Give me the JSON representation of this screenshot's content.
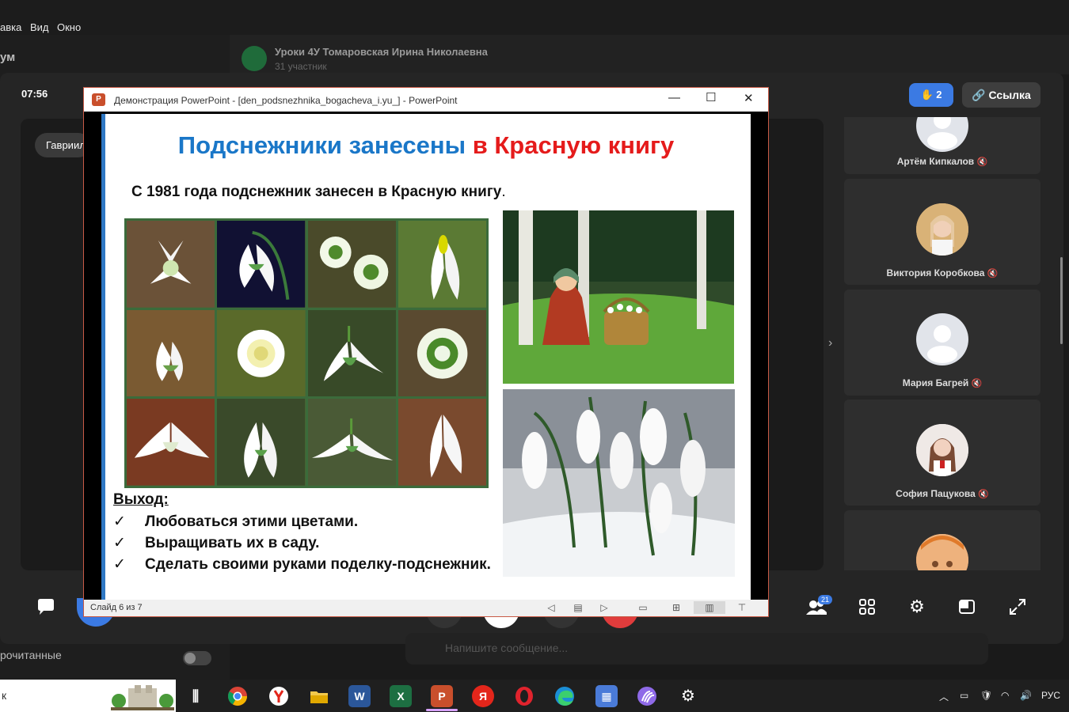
{
  "menubar": {
    "items": [
      "авка",
      "Вид",
      "Окно"
    ]
  },
  "messenger": {
    "app_name": "ум",
    "chat_title": "Уроки 4У Томаровская Ирина Николаевна",
    "chat_subtitle": "31 участник",
    "unread_label": "рочитанные",
    "message_placeholder": "Напишите сообщение..."
  },
  "call": {
    "timer": "07:56",
    "speaker_name": "Гавриил",
    "raised_hands": "2",
    "link_button": "Ссылка",
    "participants_count": "21",
    "participants": [
      {
        "name": "Артём Кипкалов",
        "avatar": "default-avatar-icon"
      },
      {
        "name": "Виктория Коробкова",
        "avatar": "photo"
      },
      {
        "name": "Мария Багрей",
        "avatar": "default-avatar-icon"
      },
      {
        "name": "София Пацукова",
        "avatar": "photo"
      },
      {
        "name": "",
        "avatar": "photo"
      }
    ]
  },
  "ppt": {
    "window_title": "Демонстрация PowerPoint - [den_podsnezhnika_bogacheva_i.yu_] - PowerPoint",
    "status": "Слайд 6 из 7",
    "slide": {
      "title_blue": "Подснежники занесены ",
      "title_red": "в Красную книгу",
      "subtitle": "С 1981 года подснежник занесен в Красную книгу",
      "subtitle_end": ".",
      "conclusion_label": "Выход:",
      "items": [
        "Любоваться этими цветами.",
        "Выращивать их в саду.",
        "Сделать  своими руками поделку-подснежник."
      ]
    }
  },
  "taskbar": {
    "search_text": "к",
    "language": "РУС",
    "apps": [
      "task-view-icon",
      "chrome-icon",
      "yandex-browser-icon",
      "file-explorer-icon",
      "word-icon",
      "excel-icon",
      "powerpoint-icon",
      "yandex-icon",
      "opera-icon",
      "edge-icon",
      "store-icon",
      "vk-icon",
      "settings-icon"
    ]
  },
  "colors": {
    "accent_blue": "#3b7ae3",
    "slide_title_blue": "#1a77c8",
    "slide_title_red": "#e51b1b",
    "ppt_border": "#c75a46"
  }
}
